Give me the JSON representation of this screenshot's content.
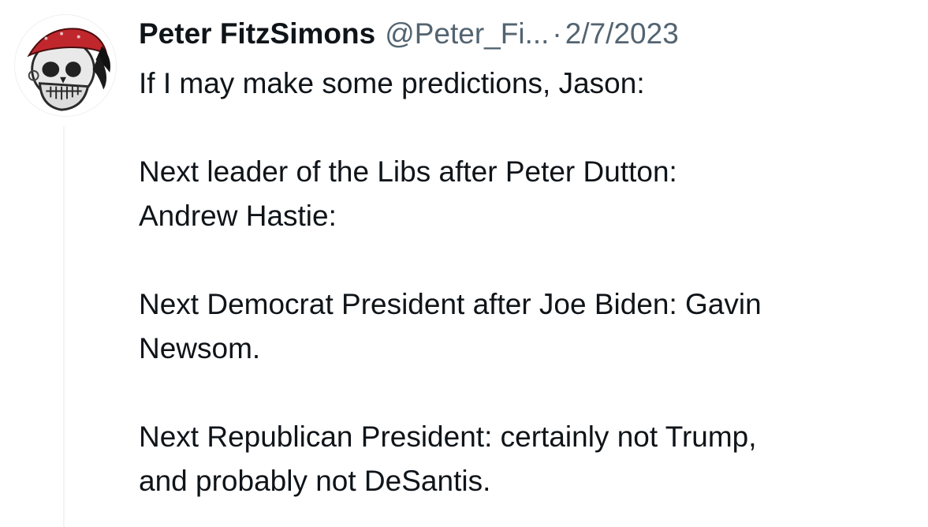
{
  "tweet": {
    "display_name": "Peter FitzSimons",
    "handle": "@Peter_Fi...",
    "separator": "·",
    "date": "2/7/2023",
    "paragraphs": [
      [
        "If I may make some predictions, Jason:"
      ],
      [
        "Next leader of the Libs after Peter Dutton:",
        "Andrew Hastie:"
      ],
      [
        "Next Democrat President after Joe Biden: Gavin",
        "Newsom."
      ],
      [
        "Next Republican President: certainly not Trump,",
        "and probably not DeSantis."
      ]
    ],
    "avatar_icon": "skull-bandana-avatar",
    "colors": {
      "text": "#0f1419",
      "secondary": "#536471",
      "bandana": "#c0272d"
    }
  }
}
